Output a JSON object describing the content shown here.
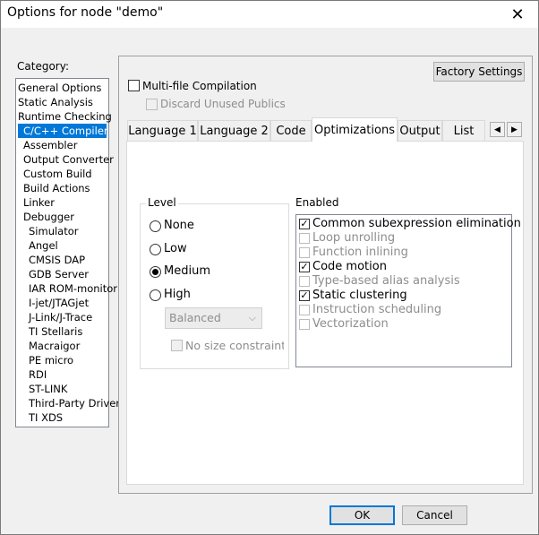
{
  "window": {
    "title": "Options for node \"demo\"",
    "close_glyph": "✕"
  },
  "category": {
    "label": "Category:",
    "items": [
      "General Options",
      "Static Analysis",
      "Runtime Checking",
      "C/C++ Compiler",
      "Assembler",
      "Output Converter",
      "Custom Build",
      "Build Actions",
      "Linker",
      "Debugger",
      "Simulator",
      "Angel",
      "CMSIS DAP",
      "GDB Server",
      "IAR ROM-monitor",
      "I-jet/JTAGjet",
      "J-Link/J-Trace",
      "TI Stellaris",
      "Macraigor",
      "PE micro",
      "RDI",
      "ST-LINK",
      "Third-Party Driver",
      "TI XDS"
    ],
    "selected": "C/C++ Compiler"
  },
  "panel": {
    "factory_settings": "Factory Settings",
    "multi_file": "Multi-file Compilation",
    "multi_file_checked": false,
    "discard": "Discard Unused Publics",
    "discard_checked": false
  },
  "tabs": [
    "Language 1",
    "Language 2",
    "Code",
    "Optimizations",
    "Output",
    "List"
  ],
  "active_tab": "Optimizations",
  "tab_scroll": {
    "left": "◀",
    "right": "▶"
  },
  "level": {
    "title": "Level",
    "options": [
      "None",
      "Low",
      "Medium",
      "High"
    ],
    "selected": "Medium",
    "high_mode": "Balanced",
    "chevron": "⌵",
    "no_size": "No size constraints",
    "no_size_checked": false
  },
  "enabled": {
    "title": "Enabled",
    "check_glyph": "✓",
    "items": [
      {
        "label": "Common subexpression elimination",
        "checked": true,
        "enabled": true
      },
      {
        "label": "Loop unrolling",
        "checked": false,
        "enabled": false
      },
      {
        "label": "Function inlining",
        "checked": false,
        "enabled": false
      },
      {
        "label": "Code motion",
        "checked": true,
        "enabled": true
      },
      {
        "label": "Type-based alias analysis",
        "checked": false,
        "enabled": false
      },
      {
        "label": "Static clustering",
        "checked": true,
        "enabled": true
      },
      {
        "label": "Instruction scheduling",
        "checked": false,
        "enabled": false
      },
      {
        "label": "Vectorization",
        "checked": false,
        "enabled": false
      }
    ]
  },
  "buttons": {
    "ok": "OK",
    "cancel": "Cancel"
  }
}
